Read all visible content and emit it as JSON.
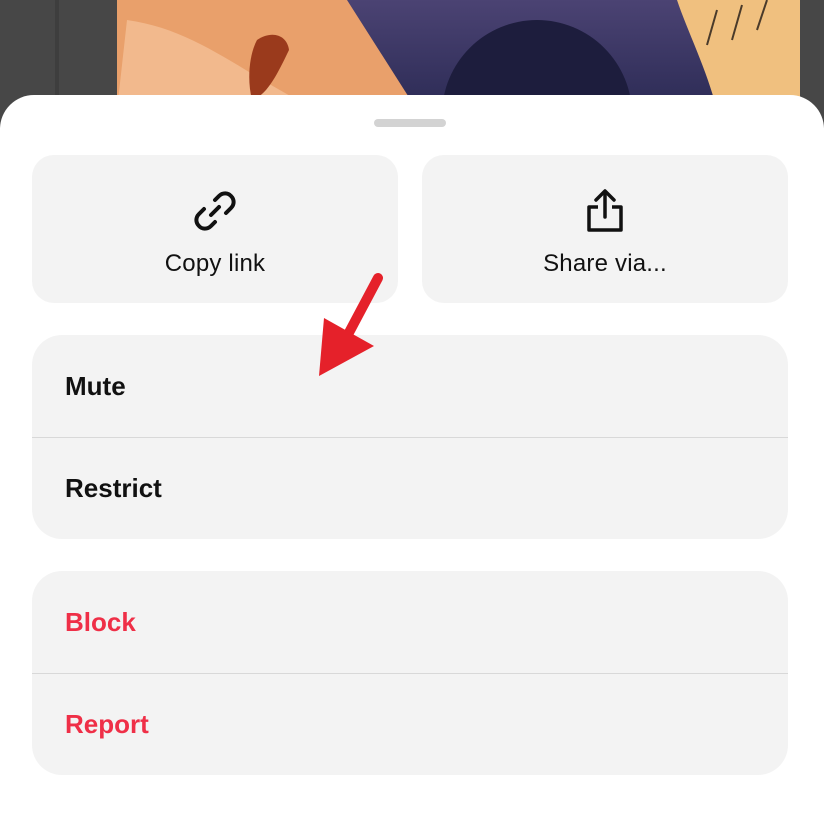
{
  "share_tiles": [
    {
      "label": "Copy link",
      "icon": "link-icon"
    },
    {
      "label": "Share via...",
      "icon": "share-icon"
    }
  ],
  "groups": [
    {
      "items": [
        {
          "label": "Mute"
        },
        {
          "label": "Restrict"
        }
      ]
    },
    {
      "items": [
        {
          "label": "Block"
        },
        {
          "label": "Report"
        }
      ]
    }
  ],
  "colors": {
    "sheet_background": "#ffffff",
    "row_background": "#f3f3f3",
    "danger_text": "#ef2f47",
    "annotation_arrow": "#e5212a"
  }
}
